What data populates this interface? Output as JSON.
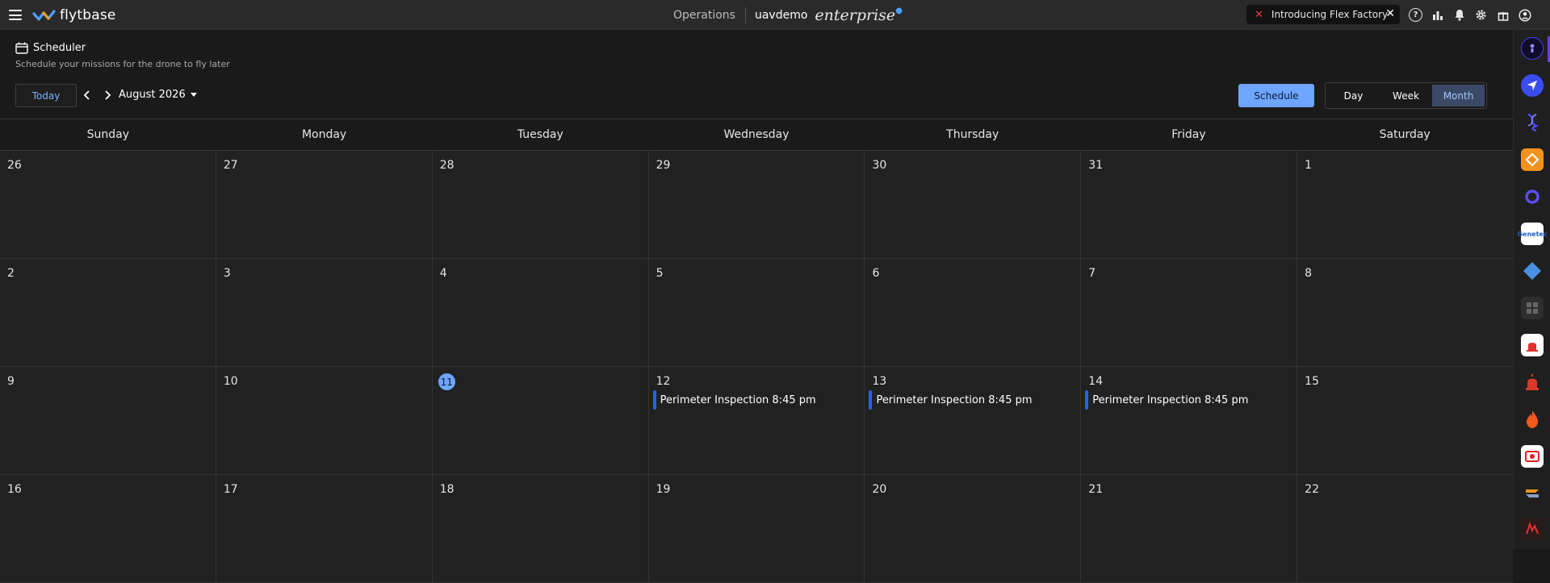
{
  "topbar": {
    "logo_text": "flytbase",
    "operations": "Operations",
    "org": "uavdemo",
    "edition": "enterprise",
    "promo": "Introducing Flex Factory",
    "icons": [
      "help-icon",
      "analytics-icon",
      "bell-icon",
      "gear-icon",
      "gift-icon",
      "account-icon"
    ]
  },
  "header": {
    "title": "Scheduler",
    "subtitle": "Schedule your missions for the drone to fly later",
    "today_label": "Today",
    "month_label": "August 2026",
    "schedule_label": "Schedule",
    "views": [
      "Day",
      "Week",
      "Month"
    ],
    "selected_view": "Month"
  },
  "calendar": {
    "weekdays": [
      "Sunday",
      "Monday",
      "Tuesday",
      "Wednesday",
      "Thursday",
      "Friday",
      "Saturday"
    ],
    "weeks": [
      [
        "26",
        "27",
        "28",
        "29",
        "30",
        "31",
        "1"
      ],
      [
        "2",
        "3",
        "4",
        "5",
        "6",
        "7",
        "8"
      ],
      [
        "9",
        "10",
        "11",
        "12",
        "13",
        "14",
        "15"
      ],
      [
        "16",
        "17",
        "18",
        "19",
        "20",
        "21",
        "22"
      ]
    ],
    "today": "11",
    "events": [
      {
        "day": "12",
        "label": "Perimeter Inspection 8:45 pm"
      },
      {
        "day": "13",
        "label": "Perimeter Inspection 8:45 pm"
      },
      {
        "day": "14",
        "label": "Perimeter Inspection 8:45 pm"
      }
    ]
  },
  "colors": {
    "accent": "#6ea6ff",
    "event_bar": "#2563eb",
    "background": "#1a1a1a"
  }
}
